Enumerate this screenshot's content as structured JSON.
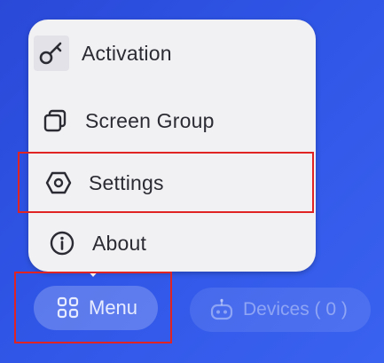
{
  "menu": {
    "items": [
      {
        "label": "Activation",
        "icon": "key-icon"
      },
      {
        "label": "Screen Group",
        "icon": "stacked-squares-icon"
      },
      {
        "label": "Settings",
        "icon": "hexagon-settings-icon"
      },
      {
        "label": "About",
        "icon": "info-icon"
      }
    ]
  },
  "bottom_bar": {
    "menu_label": "Menu",
    "menu_icon": "grid-icon",
    "devices_label": "Devices ( 0 )",
    "devices_icon": "robot-icon"
  },
  "colors": {
    "background": "#2f55e6",
    "panel": "#f1f1f4",
    "highlight": "#e02424",
    "text": "#2b2b33"
  }
}
